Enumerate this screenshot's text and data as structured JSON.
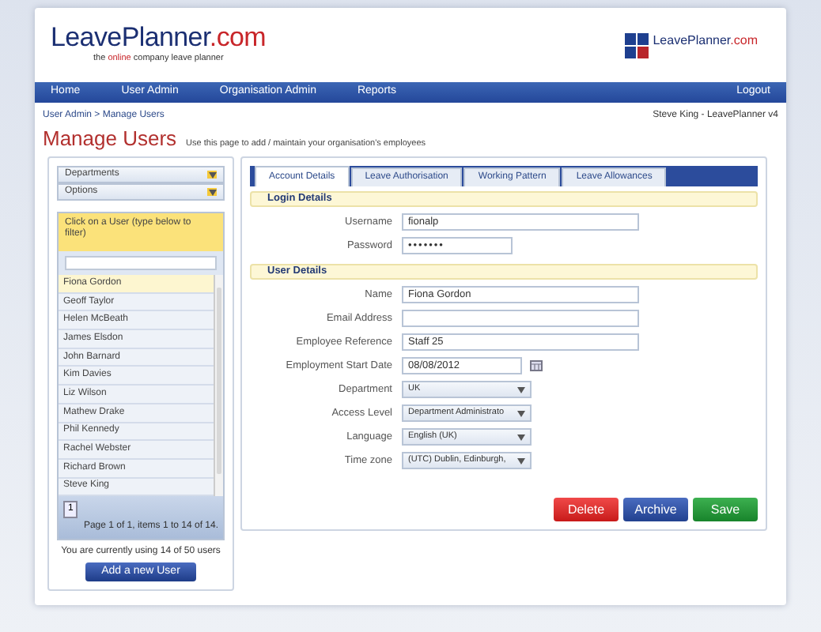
{
  "header": {
    "logo": {
      "name": "LeavePlanner",
      "suffix": ".com",
      "tagline": [
        "the ",
        "online",
        " company leave planner"
      ]
    },
    "right_logo": {
      "name": "LeavePlanner",
      "suffix": ".com"
    }
  },
  "nav": {
    "items": [
      "Home",
      "User Admin",
      "Organisation Admin",
      "Reports"
    ],
    "logout": "Logout"
  },
  "breadcrumb": "User Admin > Manage Users",
  "user": "Steve King - LeavePlanner v4",
  "page": {
    "title": "Manage Users",
    "subtitle": "Use this page to add / maintain your organisation's employees"
  },
  "sidebar": {
    "dropdowns": [
      "Departments",
      "Options"
    ],
    "list_header": "Click on a User (type below to filter)",
    "users": [
      {
        "name": "Fiona Gordon",
        "selected": true
      },
      {
        "name": "Geoff Taylor",
        "selected": false
      },
      {
        "name": "Helen McBeath",
        "selected": false
      },
      {
        "name": "James Elsdon",
        "selected": false
      },
      {
        "name": "John Barnard",
        "selected": false
      },
      {
        "name": "Kim Davies",
        "selected": false
      },
      {
        "name": "Liz Wilson",
        "selected": false
      },
      {
        "name": "Mathew Drake",
        "selected": false
      },
      {
        "name": "Phil Kennedy",
        "selected": false
      },
      {
        "name": "Rachel Webster",
        "selected": false
      },
      {
        "name": "Richard Brown",
        "selected": false
      },
      {
        "name": "Steve King",
        "selected": false
      }
    ],
    "pager": "1",
    "pager_text": "Page 1 of 1, items 1 to 14 of 14.",
    "usage": "You are currently using 14 of 50 users",
    "add_button": "Add a new User"
  },
  "tabs": [
    {
      "label": "Account Details",
      "selected": true
    },
    {
      "label": "Leave Authorisation",
      "selected": false
    },
    {
      "label": "Working Pattern",
      "selected": false
    },
    {
      "label": "Leave Allowances",
      "selected": false
    }
  ],
  "sections": [
    {
      "title": "Login Details",
      "fields": [
        {
          "label": "Username",
          "kind": "text",
          "value": "fionalp"
        },
        {
          "label": "Password",
          "kind": "password",
          "value": "•••••••"
        }
      ]
    },
    {
      "title": "User Details",
      "fields": [
        {
          "label": "Name",
          "kind": "text",
          "value": "Fiona Gordon"
        },
        {
          "label": "Email Address",
          "kind": "text"
        },
        {
          "label": "Employee Reference",
          "kind": "text",
          "value": "Staff 25"
        },
        {
          "label": "Employment Start Date",
          "kind": "date",
          "value": "08/08/2012"
        },
        {
          "label": "Department",
          "kind": "select",
          "value": "UK"
        },
        {
          "label": "Access Level",
          "kind": "select",
          "value": "Department Administrato"
        },
        {
          "label": "Language",
          "kind": "select",
          "value": "English (UK)"
        },
        {
          "label": "Time zone",
          "kind": "select",
          "value": "(UTC) Dublin, Edinburgh,"
        }
      ]
    }
  ],
  "buttons": [
    {
      "label": "Delete",
      "kind": "danger"
    },
    {
      "label": "Archive",
      "kind": "primary"
    },
    {
      "label": "Save",
      "kind": "success"
    }
  ]
}
